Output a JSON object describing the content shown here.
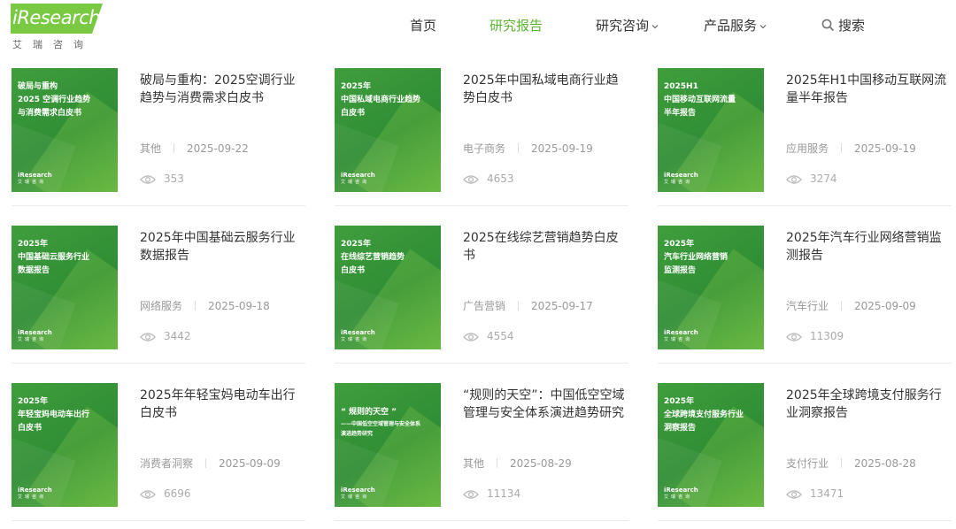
{
  "header": {
    "logo_text": "iResearch",
    "logo_sub": "艾瑞咨询",
    "nav": {
      "home": "首页",
      "report": "研究报告",
      "consult": "研究咨询",
      "product": "产品服务",
      "search": "搜索"
    },
    "accent_color": "#5cb531"
  },
  "cards": [
    {
      "cover_line1": "破局与重构",
      "cover_line2": "2025 空调行业趋势",
      "cover_line3": "与消费需求白皮书",
      "title": "破局与重构：2025空调行业趋势与消费需求白皮书",
      "category": "其他",
      "date": "2025-09-22",
      "views": "353"
    },
    {
      "cover_line1": "2025年",
      "cover_line2": "中国私域电商行业趋势",
      "cover_line3": "白皮书",
      "title": "2025年中国私域电商行业趋势白皮书",
      "category": "电子商务",
      "date": "2025-09-19",
      "views": "4653"
    },
    {
      "cover_line1": "2025H1",
      "cover_line2": "中国移动互联网流量",
      "cover_line3": "半年报告",
      "title": "2025年H1中国移动互联网流量半年报告",
      "category": "应用服务",
      "date": "2025-09-19",
      "views": "3274"
    },
    {
      "cover_line1": "2025年",
      "cover_line2": "中国基础云服务行业",
      "cover_line3": "数据报告",
      "title": "2025年中国基础云服务行业数据报告",
      "category": "网络服务",
      "date": "2025-09-18",
      "views": "3442"
    },
    {
      "cover_line1": "2025年",
      "cover_line2": "在线综艺营销趋势",
      "cover_line3": "白皮书",
      "title": "2025在线综艺营销趋势白皮书",
      "category": "广告营销",
      "date": "2025-09-17",
      "views": "4554"
    },
    {
      "cover_line1": "2025年",
      "cover_line2": "汽车行业网络营销",
      "cover_line3": "监测报告",
      "title": "2025年汽车行业网络营销监测报告",
      "category": "汽车行业",
      "date": "2025-09-09",
      "views": "11309"
    },
    {
      "cover_line1": "2025年",
      "cover_line2": "年轻宝妈电动车出行",
      "cover_line3": "白皮书",
      "title": "2025年年轻宝妈电动车出行白皮书",
      "category": "消费者洞察",
      "date": "2025-09-09",
      "views": "6696"
    },
    {
      "cover_line1": "“ 规则的天空 ”",
      "cover_line2": "——中国低空空域管理与安全体系",
      "cover_line3": "演进趋势研究",
      "title": "“规则的天空”：中国低空空域管理与安全体系演进趋势研究",
      "category": "其他",
      "date": "2025-08-29",
      "views": "11134"
    },
    {
      "cover_line1": "2025年",
      "cover_line2": "全球跨境支付服务行业",
      "cover_line3": "洞察报告",
      "title": "2025年全球跨境支付服务行业洞察报告",
      "category": "支付行业",
      "date": "2025-08-28",
      "views": "13471"
    }
  ],
  "cover_brand": "iResearch",
  "cover_brand_sub": "艾瑞咨询",
  "icons": {
    "search": "search-icon",
    "eye": "eye-icon",
    "chevron": "chevron-down-icon"
  }
}
